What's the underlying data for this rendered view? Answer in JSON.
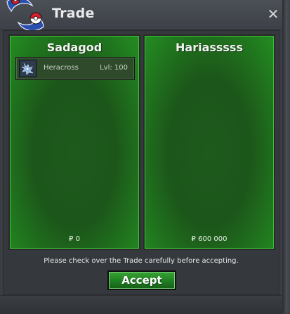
{
  "window": {
    "title": "Trade",
    "close_label": "✕"
  },
  "left_panel": {
    "trainer_name": "Sadagod",
    "items": [
      {
        "name": "Heracross",
        "level": "Lvl: 100",
        "icon": "heracross-icon"
      }
    ],
    "money": "₽ 0"
  },
  "right_panel": {
    "trainer_name": "Hariasssss",
    "items": [],
    "money": "₽ 600 000"
  },
  "notice": "Please check over the Trade carefully before accepting.",
  "accept_label": "Accept",
  "colors": {
    "panel_green": "#1f5a1d",
    "panel_edge_green": "#238d21",
    "button_green": "#1f7f21",
    "window_bg": "#3a3d42"
  }
}
